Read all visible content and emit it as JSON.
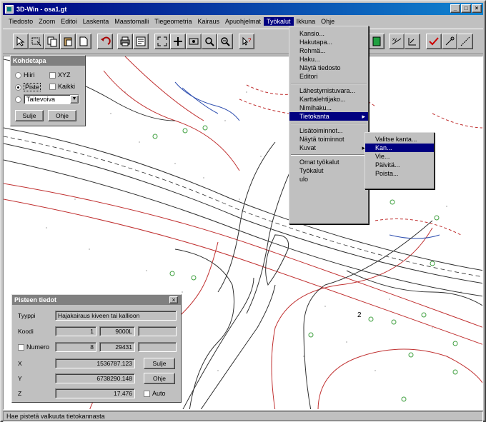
{
  "window": {
    "title": "3D-Win - osa1.gt"
  },
  "menubar": [
    "Tiedosto",
    "Zoom",
    "Editoi",
    "Laskenta",
    "Maastomalli",
    "Tiegeometria",
    "Kairaus",
    "Apuohjelmat",
    "Työkalut",
    "Ikkuna",
    "Ohje"
  ],
  "active_menu": "Työkalut",
  "tools_menu": {
    "items_a": [
      "Kansio...",
      "Hakutapa...",
      "Rohmä...",
      "Haku...",
      "Näytä tiedosto",
      "Editori"
    ],
    "items_b": [
      "Lähestymistuvara...",
      "Karttalehtijako...",
      "Nimihaku..."
    ],
    "highlighted": "Tietokanta",
    "items_c": [
      "Lisätoiminnot...",
      "Näytä toiminnot",
      "Kuvat"
    ],
    "items_d": [
      "Omat työkalut",
      "Työkalut",
      "ulo"
    ]
  },
  "submenu": {
    "items": [
      "Valitse kanta...",
      "Kan...",
      "Vie...",
      "Päivitä...",
      "Poista..."
    ],
    "highlighted_index": 1
  },
  "left_panel": {
    "title": "Kohdetapa",
    "options": [
      "Hiiri",
      "XYZ",
      "Piste",
      "Kaikki",
      "Taitevoiva"
    ],
    "close_label": "Sulje",
    "help_label": "Ohje"
  },
  "props_panel": {
    "title": "Pisteen tiedot",
    "type_label": "Tyyppi",
    "type_value": "Hajakairaus kiveen tai kallioon",
    "code_label": "Koodi",
    "code_values": [
      "1",
      "9000L",
      ""
    ],
    "number_label": "Numero",
    "number_values": [
      "8",
      "29431",
      ""
    ],
    "x_label": "X",
    "x_value": "1536787.123",
    "y_label": "Y",
    "y_value": "6738290.148",
    "z_label": "Z",
    "z_value": "17.476",
    "close_label": "Sulje",
    "help_label": "Ohje",
    "auto_label": "Auto"
  },
  "map_label": "2",
  "statusbar": {
    "text": "Hae pistetä valkuuta tietokannasta"
  },
  "colors": {
    "titlebar": "#000080",
    "menu_highlight": "#000080",
    "road_red": "#c03030",
    "road_blue": "#3050b0",
    "tree_green": "#40a040"
  }
}
